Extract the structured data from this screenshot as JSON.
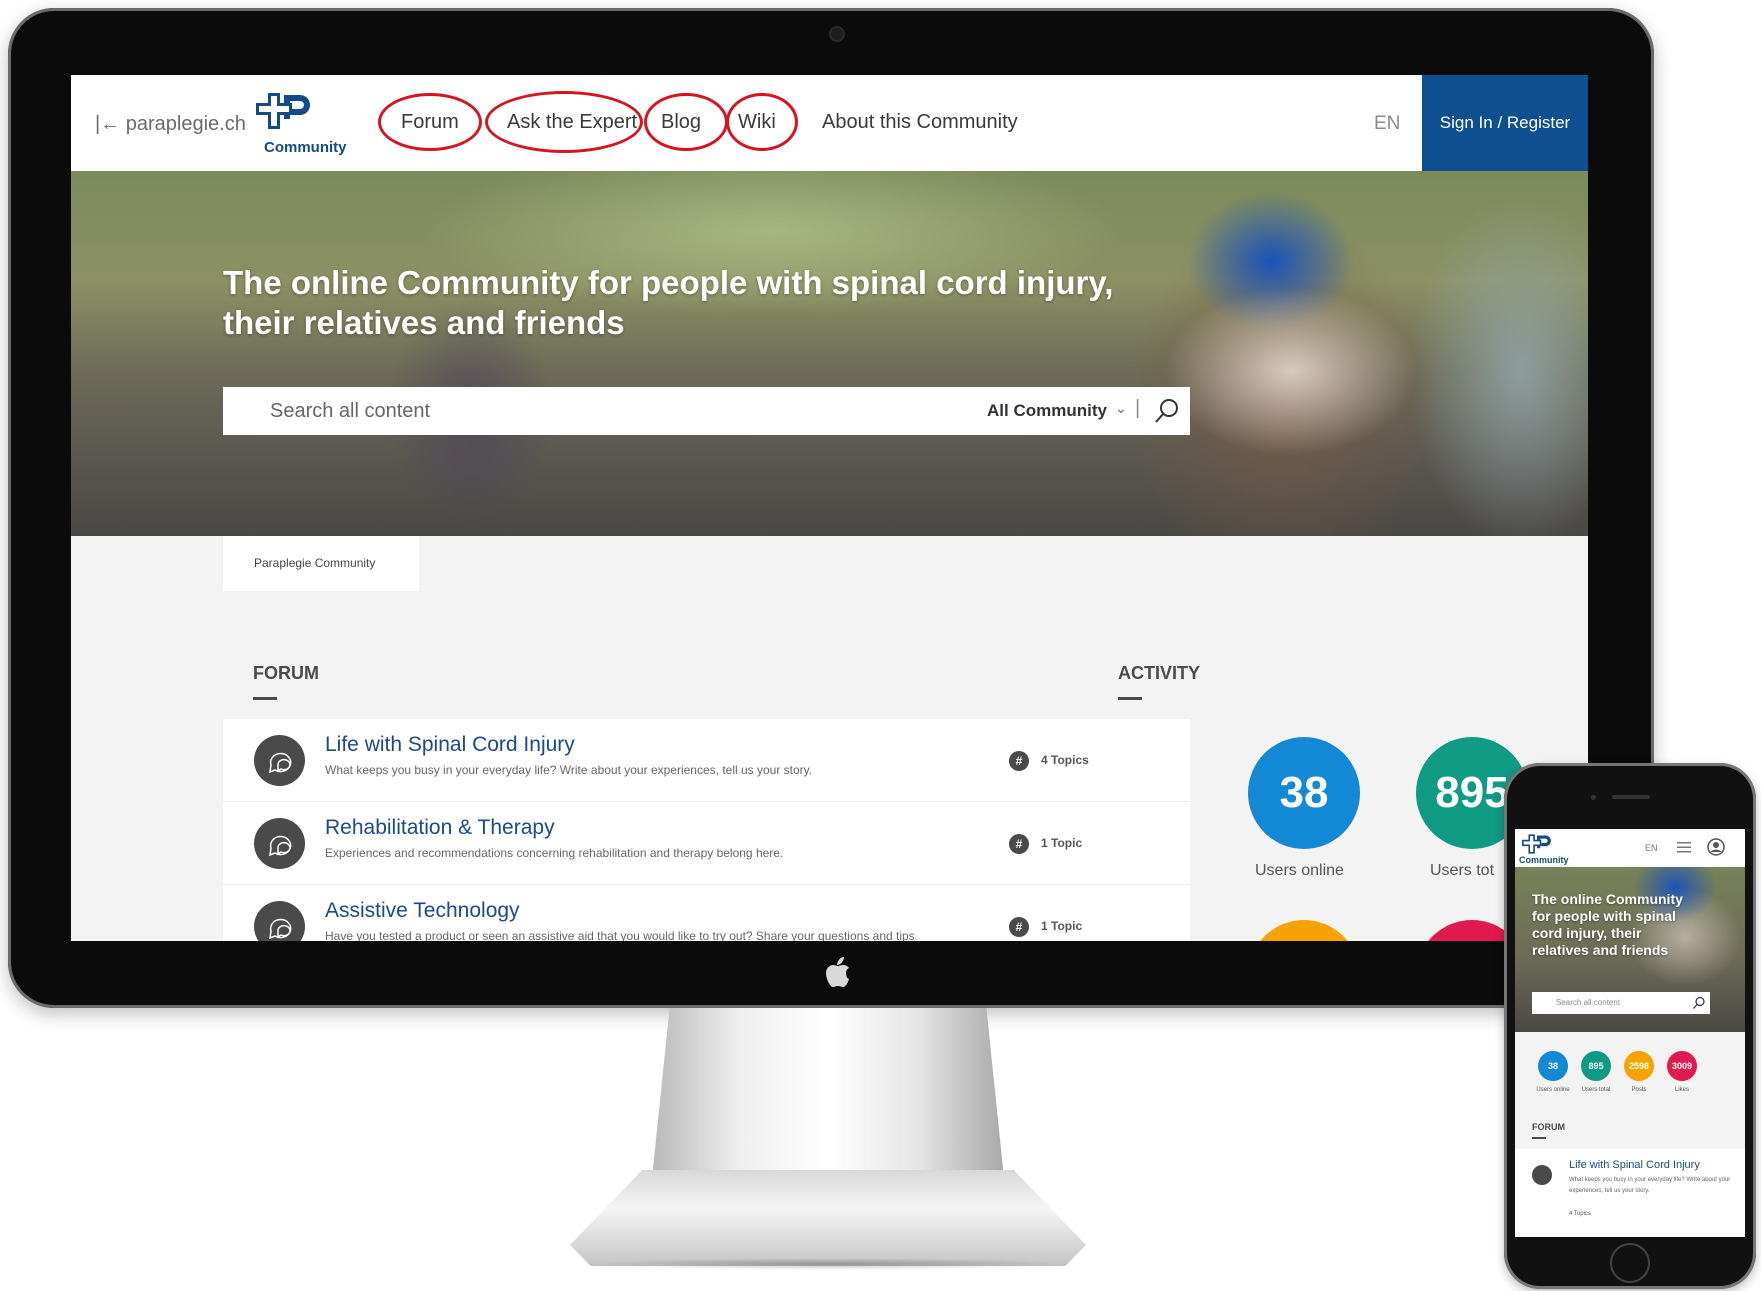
{
  "nav": {
    "back_link": "|← paraplegie.ch",
    "logo_text": "Community",
    "items": [
      {
        "label": "Forum"
      },
      {
        "label": "Ask the Expert"
      },
      {
        "label": "Blog"
      },
      {
        "label": "Wiki"
      },
      {
        "label": "About this Community"
      }
    ],
    "lang": "EN",
    "signin": "Sign In / Register"
  },
  "hero": {
    "title": "The online Community for people with spinal cord injury, their relatives and friends",
    "search_placeholder": "Search all content",
    "scope": "All Community",
    "scope_chevron": "⌄",
    "separator": "|"
  },
  "breadcrumb": "Paraplegie Community",
  "forum": {
    "heading": "FORUM",
    "items": [
      {
        "title": "Life with Spinal Cord Injury",
        "desc": "What keeps you busy in your everyday life? Write about your experiences, tell us your story.",
        "topics": "4 Topics"
      },
      {
        "title": "Rehabilitation & Therapy",
        "desc": "Experiences and recommendations concerning rehabilitation and therapy belong here.",
        "topics": "1 Topic"
      },
      {
        "title": "Assistive Technology",
        "desc": "Have you tested a product or seen an assistive aid that you would like to try out? Share your questions and tips",
        "topics": "1 Topic"
      }
    ]
  },
  "activity": {
    "heading": "ACTIVITY",
    "stats": [
      {
        "value": "38",
        "label": "Users online",
        "color": "#1389d6"
      },
      {
        "value": "895",
        "label": "Users tot",
        "color": "#0f9a84"
      },
      {
        "value": "",
        "label": "",
        "color": "#f5a300"
      },
      {
        "value": "",
        "label": "",
        "color": "#e0194f"
      }
    ]
  },
  "mobile": {
    "logo_text": "Community",
    "lang": "EN",
    "hero_title": "The online Community for people with spinal cord injury, their relatives and friends",
    "search_placeholder": "Search all content",
    "stats": [
      {
        "value": "38",
        "label": "Users online",
        "color": "#1389d6"
      },
      {
        "value": "895",
        "label": "Users total",
        "color": "#0f9a84"
      },
      {
        "value": "2598",
        "label": "Posts",
        "color": "#f5a300"
      },
      {
        "value": "3009",
        "label": "Likes",
        "color": "#e0194f"
      }
    ],
    "forum_heading": "FORUM",
    "card": {
      "title": "Life with Spinal Cord Injury",
      "desc": "What keeps you busy in your everyday life? Write about your experiences, tell us your story.",
      "topics": "4 Topics"
    }
  },
  "colors": {
    "brand_blue": "#0e4f8f",
    "link_blue": "#1b4a8c",
    "highlight_red": "#d6141f"
  }
}
